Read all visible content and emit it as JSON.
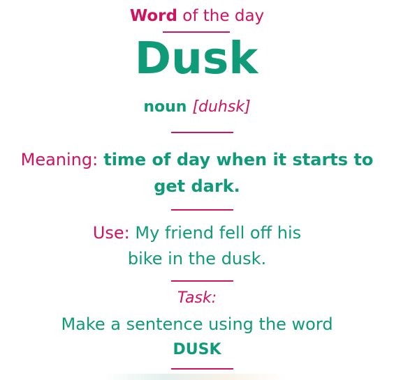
{
  "header": {
    "word_label": "Word",
    "rest_label": " of the day"
  },
  "word": "Dusk",
  "pronunciation": {
    "part_of_speech": "noun",
    "phonetic": "[duhsk]"
  },
  "meaning": {
    "label": "Meaning:",
    "line1": "time of day when it starts to",
    "line2": "get dark."
  },
  "use": {
    "label": "Use:",
    "line1": " My friend fell off his",
    "line2": "bike in the dusk."
  },
  "task": {
    "label": "Task:",
    "line1": "Make a sentence using the word",
    "line2": "DUSK"
  },
  "colors": {
    "pink": "#d1125f",
    "teal": "#0f9a78"
  }
}
